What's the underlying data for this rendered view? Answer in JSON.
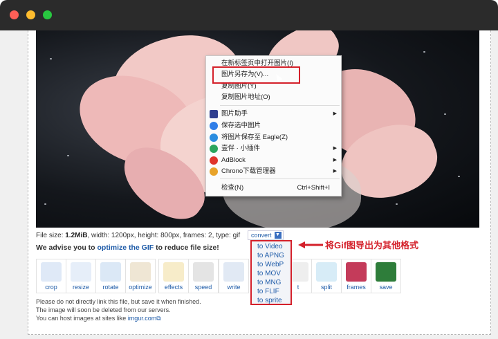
{
  "window": {
    "buttons": [
      "close",
      "minimize",
      "zoom"
    ]
  },
  "context_menu": {
    "items": [
      {
        "label": "在新标签页中打开图片(I)",
        "shortcut": "",
        "submenu": false,
        "icon": ""
      },
      {
        "label": "图片另存为(V)...",
        "shortcut": "",
        "submenu": false,
        "icon": "",
        "highlighted": true
      },
      {
        "label": "复制图片(Y)",
        "shortcut": "",
        "submenu": false,
        "icon": ""
      },
      {
        "label": "复制图片地址(O)",
        "shortcut": "",
        "submenu": false,
        "icon": ""
      },
      {
        "label": "图片助手",
        "shortcut": "",
        "submenu": true,
        "icon": "ia-icon",
        "color": "#2f3e8f"
      },
      {
        "label": "保存选中图片",
        "shortcut": "",
        "submenu": false,
        "icon": "drop-icon",
        "color": "#2f7ee8"
      },
      {
        "label": "将图片保存至 Eagle(Z)",
        "shortcut": "",
        "submenu": false,
        "icon": "eagle-icon",
        "color": "#2a8de0"
      },
      {
        "label": "壹伴 · 小插件",
        "shortcut": "",
        "submenu": true,
        "icon": "yiban-icon",
        "color": "#2ba55d"
      },
      {
        "label": "AdBlock",
        "shortcut": "",
        "submenu": true,
        "icon": "adblock-icon",
        "color": "#e0342b"
      },
      {
        "label": "Chrono下载管理器",
        "shortcut": "",
        "submenu": true,
        "icon": "chrono-icon",
        "color": "#e8a32a"
      },
      {
        "label": "检查(N)",
        "shortcut": "Ctrl+Shift+I",
        "submenu": false,
        "icon": ""
      }
    ]
  },
  "file_info": {
    "prefix": "File size: ",
    "size": "1.2MiB",
    "rest": ", width: 1200px, height: 800px, frames: 2, type: gif",
    "convert_label": "convert"
  },
  "advise": {
    "before": "We advise you to ",
    "link": "optimize the GIF",
    "after": " to reduce file size!"
  },
  "tools": [
    {
      "label": "crop",
      "icon": "crop-icon"
    },
    {
      "label": "resize",
      "icon": "resize-icon"
    },
    {
      "label": "rotate",
      "icon": "rotate-icon"
    },
    {
      "label": "optimize",
      "icon": "optimize-icon"
    },
    {
      "label": "effects",
      "icon": "effects-icon"
    },
    {
      "label": "speed",
      "icon": "speed-icon"
    },
    {
      "label": "write",
      "icon": "write-icon"
    },
    {
      "label": "t",
      "icon": "cut-icon"
    },
    {
      "label": "split",
      "icon": "split-icon"
    },
    {
      "label": "frames",
      "icon": "frames-icon"
    },
    {
      "label": "save",
      "icon": "save-icon"
    }
  ],
  "convert_menu": [
    "to Video",
    "to APNG",
    "to WebP",
    "to MOV",
    "to MNG",
    "to FLIF",
    "to sprite"
  ],
  "annotation": "将Gif图导出为其他格式",
  "notes": {
    "line1": "Please do not directly link this file, but save it when finished.",
    "line2": "The image will soon be deleted from our servers.",
    "line3_before": "You can host images at sites like ",
    "line3_link": "imgur.com"
  },
  "colors": {
    "accent": "#1e5ba8",
    "highlight": "#d4202a"
  }
}
